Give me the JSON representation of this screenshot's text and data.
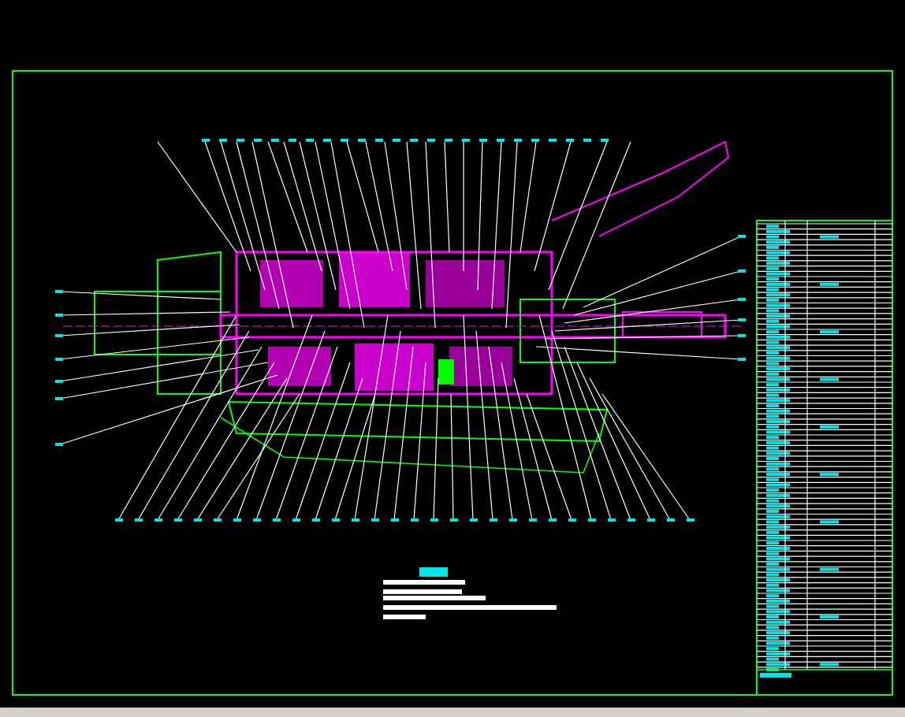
{
  "sheet": {
    "kind": "cad"
  }
}
